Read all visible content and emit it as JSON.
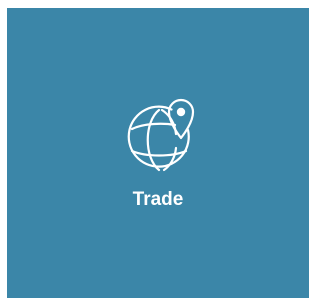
{
  "tile": {
    "label": "Trade",
    "icon": "globe-location-pin-icon",
    "background_color": "#3b86a8",
    "foreground_color": "#ffffff"
  }
}
